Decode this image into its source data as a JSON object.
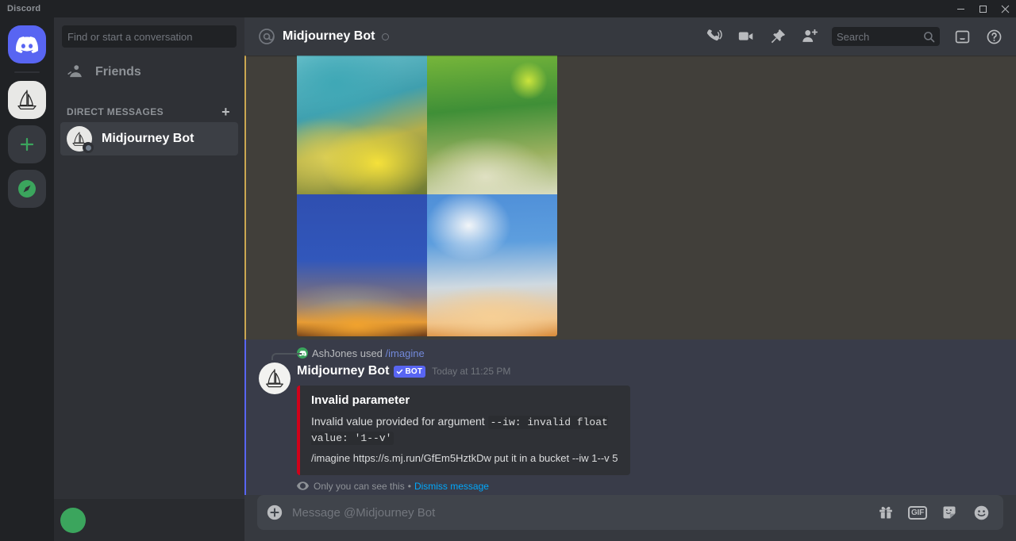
{
  "window": {
    "app_title": "Discord",
    "minimize_label": "Minimize",
    "maximize_label": "Maximize",
    "close_label": "Close"
  },
  "server_rail": {
    "items": [
      {
        "name": "discord-home",
        "label": "Home",
        "icon": "discord-logo-icon"
      },
      {
        "name": "midjourney-server",
        "label": "Midjourney",
        "icon": "sailboat-icon"
      },
      {
        "name": "add-server",
        "label": "Add a Server",
        "icon": "plus-icon"
      },
      {
        "name": "explore-servers",
        "label": "Explore Public Servers",
        "icon": "compass-icon"
      }
    ]
  },
  "sidebar": {
    "search_placeholder": "Find or start a conversation",
    "search_value": "",
    "friends_label": "Friends",
    "dm_header": "DIRECT MESSAGES",
    "dm_add_label": "+",
    "dms": [
      {
        "name": "Midjourney Bot",
        "active": true,
        "status": "offline"
      }
    ],
    "user_panel": {
      "username": ""
    }
  },
  "header": {
    "at_symbol": "@",
    "title": "Midjourney Bot",
    "search_placeholder": "Search",
    "icons": [
      "start-voice-call-icon",
      "start-video-call-icon",
      "pinned-messages-icon",
      "add-friends-to-dm-icon",
      "inbox-icon",
      "help-icon"
    ]
  },
  "messages": {
    "image_grid_message": {
      "type": "image-grid",
      "mentioned": true,
      "images": [
        {
          "name": "upscale-variant-1",
          "alt": "teal sky over yellow blossoms"
        },
        {
          "name": "upscale-variant-2",
          "alt": "green foliage with bright highlight"
        },
        {
          "name": "upscale-variant-3",
          "alt": "blue sky over orange sunset horizon"
        },
        {
          "name": "upscale-variant-4",
          "alt": "blue sky with white clouds and warm haze"
        }
      ]
    },
    "bot_error_message": {
      "reply_user": "AshJones",
      "reply_verb": "used",
      "reply_command": "/imagine",
      "author": "Midjourney Bot",
      "bot_tag": "BOT",
      "timestamp": "Today at 11:25 PM",
      "embed": {
        "accent_color": "#d0021b",
        "title": "Invalid parameter",
        "description_prefix": "Invalid value provided for argument ",
        "description_code": "--iw: invalid float value: '1--v'",
        "subtext": "/imagine https://s.mj.run/GfEm5HztkDw put it in a bucket --iw 1--v 5"
      },
      "footer": {
        "visibility_text": "Only you can see this",
        "separator": "•",
        "dismiss_label": "Dismiss message"
      }
    }
  },
  "composer": {
    "placeholder": "Message @Midjourney Bot",
    "value": "",
    "tools": [
      "gift-icon",
      "gif-icon",
      "sticker-icon",
      "emoji-icon"
    ],
    "gif_label": "GIF"
  },
  "colors": {
    "brand": "#5865f2",
    "error": "#d0021b",
    "mention_accent": "#cba751",
    "link": "#00a8fc",
    "command": "#7289da",
    "online": "#3ba55d"
  }
}
